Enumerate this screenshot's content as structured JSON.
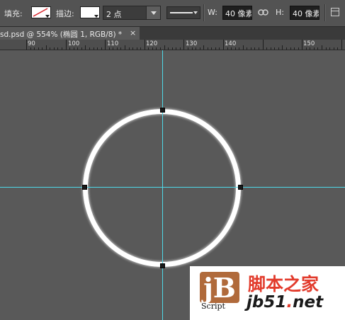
{
  "options_bar": {
    "fill_label": "填充:",
    "stroke_label": "描边:",
    "stroke_width_value": "2 点",
    "width_label": "W:",
    "width_value": "40 像素",
    "height_label": "H:",
    "height_value": "40 像素"
  },
  "document_tab": {
    "title": "sd.psd @ 554% (椭圆 1, RGB/8) *",
    "close_glyph": "×"
  },
  "ruler": {
    "labels": [
      "90",
      "100",
      "110",
      "120",
      "130",
      "140",
      "150"
    ]
  },
  "watermark": {
    "logo_letters": "jB",
    "logo_caption": "Script",
    "site_name": "脚本之家",
    "url_prefix": "jb51",
    "url_dot": ".",
    "url_suffix": "net"
  },
  "colors": {
    "guide": "#4fd8e8",
    "canvas": "#595959",
    "watermark_red": "#e23b2c",
    "logo_brown": "#b06a3b"
  }
}
